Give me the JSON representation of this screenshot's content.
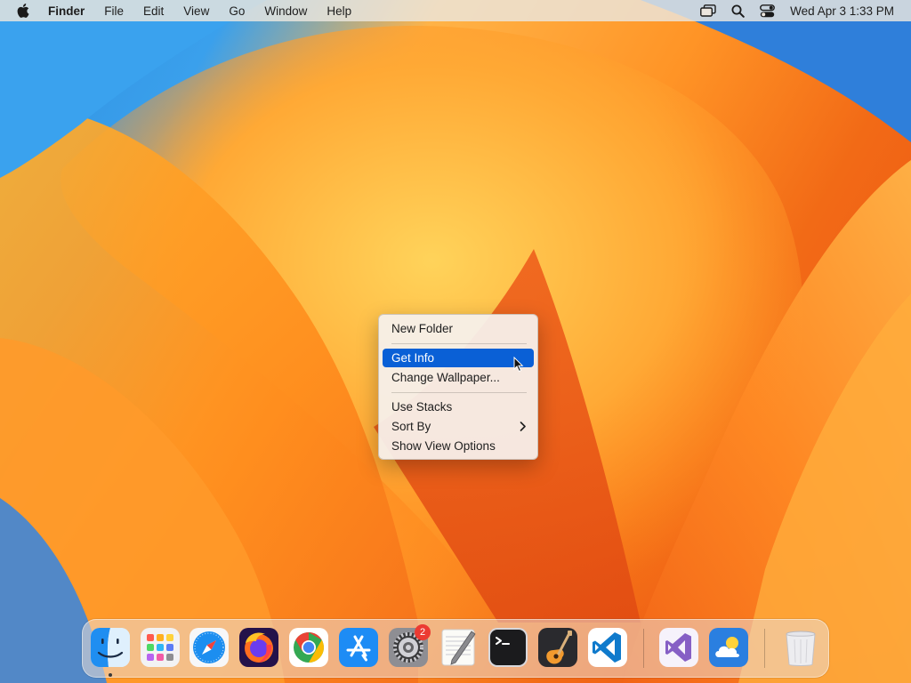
{
  "menubar": {
    "apple_icon": "apple-logo-icon",
    "app_name": "Finder",
    "menus": [
      "File",
      "Edit",
      "View",
      "Go",
      "Window",
      "Help"
    ],
    "status_icons": [
      "screen-mirroring-icon",
      "spotlight-search-icon",
      "control-center-icon"
    ],
    "clock": "Wed Apr 3  1:33 PM"
  },
  "context_menu": {
    "items": [
      {
        "label": "New Folder",
        "selected": false
      },
      {
        "label": "Get Info",
        "selected": true
      },
      {
        "label": "Change Wallpaper...",
        "selected": false
      },
      {
        "label": "Use Stacks",
        "selected": false
      },
      {
        "label": "Sort By",
        "selected": false,
        "submenu": true
      },
      {
        "label": "Show View Options",
        "selected": false
      }
    ],
    "selected_color": "#0a60d6"
  },
  "dock": {
    "apps": [
      {
        "name": "Finder",
        "icon": "finder-icon",
        "running": true
      },
      {
        "name": "Launchpad",
        "icon": "launchpad-icon"
      },
      {
        "name": "Safari",
        "icon": "safari-icon"
      },
      {
        "name": "Firefox",
        "icon": "firefox-icon"
      },
      {
        "name": "Google Chrome",
        "icon": "chrome-icon"
      },
      {
        "name": "App Store",
        "icon": "app-store-icon"
      },
      {
        "name": "System Settings",
        "icon": "system-settings-icon",
        "badge": "2"
      },
      {
        "name": "TextEdit",
        "icon": "textedit-icon"
      },
      {
        "name": "Terminal",
        "icon": "terminal-icon"
      },
      {
        "name": "GarageBand",
        "icon": "garageband-icon"
      },
      {
        "name": "Visual Studio Code",
        "icon": "vscode-icon"
      },
      {
        "name": "Visual Studio",
        "icon": "visual-studio-icon"
      },
      {
        "name": "Weather",
        "icon": "weather-icon"
      },
      {
        "name": "Trash",
        "icon": "trash-icon"
      }
    ]
  }
}
